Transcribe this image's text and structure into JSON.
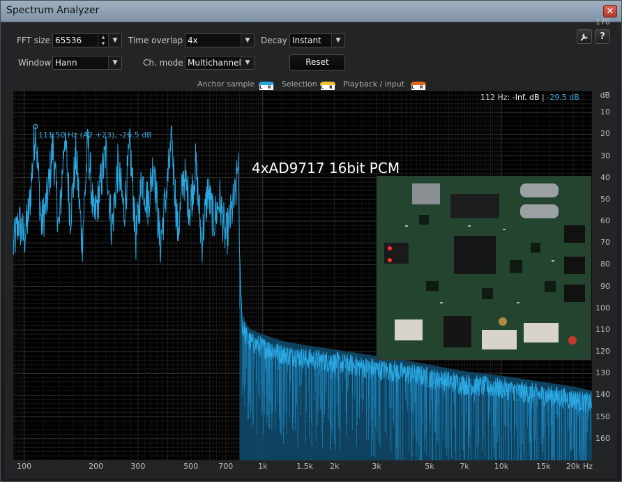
{
  "window": {
    "title": "Spectrum Analyzer",
    "close_glyph": "✕"
  },
  "controls": {
    "fft_size": {
      "label": "FFT size",
      "value": "65536"
    },
    "time_overlap": {
      "label": "Time overlap",
      "value": "4x"
    },
    "decay": {
      "label": "Decay",
      "value": "Instant"
    },
    "window_fn": {
      "label": "Window",
      "value": "Hann"
    },
    "ch_mode": {
      "label": "Ch. mode",
      "value": "Multichannel"
    },
    "reset_label": "Reset"
  },
  "toolbar": {
    "settings_icon": "wrench-icon",
    "help_label": "?"
  },
  "legend": {
    "anchor_sample": "Anchor sample",
    "selection": "Selection",
    "playback_input": "Playback / input",
    "lr_text": "L R",
    "colors": {
      "anchor": "#2aa6e0",
      "selection": "#f1c232",
      "playback": "#e06a1f"
    }
  },
  "readout": {
    "freq": "112 Hz:",
    "level": "-Inf. dB",
    "sep": "|",
    "level2": "-29.5 dB",
    "unit": "dB"
  },
  "marker": {
    "label": "111.50 Hz (A2 +23), -26.5 dB"
  },
  "overlay": {
    "caption": "4xAD9717   16bit PCM",
    "photo_label": "pcb-photo"
  },
  "chart_data": {
    "type": "line",
    "x_scale": "log",
    "xlim": [
      90,
      24000
    ],
    "ylim": [
      -180,
      -10
    ],
    "y_ticks": [
      -10,
      -20,
      -30,
      -40,
      -50,
      -60,
      -70,
      -80,
      -90,
      -100,
      -110,
      -120,
      -130,
      -140,
      -150,
      -160,
      -170
    ],
    "y_tick_labels": [
      "dB",
      "10",
      "20",
      "30",
      "40",
      "50",
      "60",
      "70",
      "80",
      "90",
      "100",
      "110",
      "120",
      "130",
      "140",
      "150",
      "160",
      "170"
    ],
    "x_ticks": [
      100,
      200,
      300,
      500,
      700,
      1000,
      1500,
      2000,
      3000,
      5000,
      7000,
      10000,
      15000,
      20000
    ],
    "x_tick_labels": [
      "100",
      "200",
      "300",
      "500",
      "700",
      "1k",
      "1.5k",
      "2k",
      "3k",
      "5k",
      "7k",
      "10k",
      "15k",
      "20k"
    ],
    "x_unit": "Hz",
    "grid": true,
    "series": [
      {
        "color": "#2aa6e0",
        "x": [
          90,
          95,
          100,
          105,
          111.5,
          118,
          125,
          132,
          140,
          148,
          156,
          165,
          175,
          185,
          196,
          208,
          220,
          233,
          247,
          262,
          278,
          294,
          312,
          330,
          350,
          371,
          393,
          416,
          441,
          467,
          495,
          524,
          555,
          588,
          623,
          660,
          700,
          740,
          770,
          790,
          800,
          820,
          860,
          900,
          1000,
          1200,
          1500,
          2000,
          3000,
          4000,
          5000,
          7000,
          10000,
          15000,
          20000,
          24000
        ],
        "y": [
          -82,
          -70,
          -78,
          -65,
          -26.5,
          -72,
          -60,
          -35,
          -75,
          -28,
          -68,
          -40,
          -80,
          -33,
          -70,
          -55,
          -38,
          -74,
          -45,
          -66,
          -36,
          -78,
          -50,
          -62,
          -42,
          -82,
          -58,
          -34,
          -76,
          -48,
          -64,
          -44,
          -80,
          -56,
          -70,
          -60,
          -78,
          -66,
          -58,
          -40,
          -88,
          -118,
          -124,
          -126,
          -128,
          -131,
          -133,
          -135,
          -138,
          -140,
          -142,
          -145,
          -147,
          -150,
          -152,
          -154
        ]
      }
    ]
  }
}
